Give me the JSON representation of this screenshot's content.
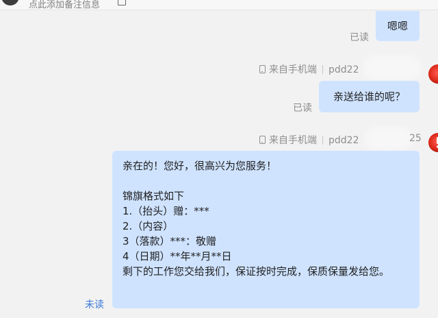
{
  "header": {
    "note_hint": "点此添加备注信息"
  },
  "messages": [
    {
      "text": "嗯嗯",
      "status": "已读"
    },
    {
      "source": "来自手机端",
      "sender": "pdd22",
      "text": "亲送给谁的呢？",
      "status": "已读"
    },
    {
      "source": "来自手机端",
      "sender": "pdd22",
      "sender_suffix": "25",
      "lines": [
        "亲在的！您好，很高兴为您服务！",
        "",
        "锦旗格式如下",
        "1.（抬头）赠：***",
        "2.（内容）",
        "3（落款）***：敬赠",
        "4（日期）**年**月**日",
        "剩下的工作您交给我们，保证按时完成，保质保量发给您。"
      ],
      "status": "未读"
    }
  ],
  "colors": {
    "bubble": "#cfe3ff",
    "unread": "#3a78d8",
    "read": "#8a8a8a"
  }
}
